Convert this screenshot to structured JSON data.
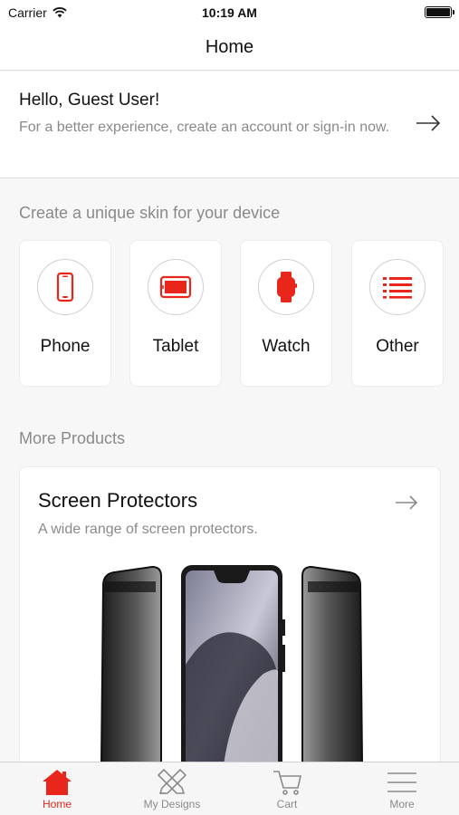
{
  "status_bar": {
    "carrier": "Carrier",
    "time": "10:19 AM"
  },
  "nav": {
    "title": "Home"
  },
  "greeting": {
    "title": "Hello, Guest User!",
    "subtitle": "For a better experience, create an account or sign-in now."
  },
  "skin_section": {
    "title": "Create a unique skin for your device",
    "devices": [
      {
        "label": "Phone",
        "icon": "phone-icon"
      },
      {
        "label": "Tablet",
        "icon": "tablet-icon"
      },
      {
        "label": "Watch",
        "icon": "watch-icon"
      },
      {
        "label": "Other",
        "icon": "list-icon"
      }
    ]
  },
  "more_products": {
    "title": "More Products",
    "card": {
      "title": "Screen Protectors",
      "subtitle": "A wide range of screen protectors."
    }
  },
  "tabs": [
    {
      "label": "Home",
      "icon": "home-icon",
      "active": true
    },
    {
      "label": "My Designs",
      "icon": "designs-icon",
      "active": false
    },
    {
      "label": "Cart",
      "icon": "cart-icon",
      "active": false
    },
    {
      "label": "More",
      "icon": "menu-icon",
      "active": false
    }
  ],
  "colors": {
    "accent": "#e8261b",
    "muted": "#8a8a8a",
    "background": "#f7f7f7"
  }
}
